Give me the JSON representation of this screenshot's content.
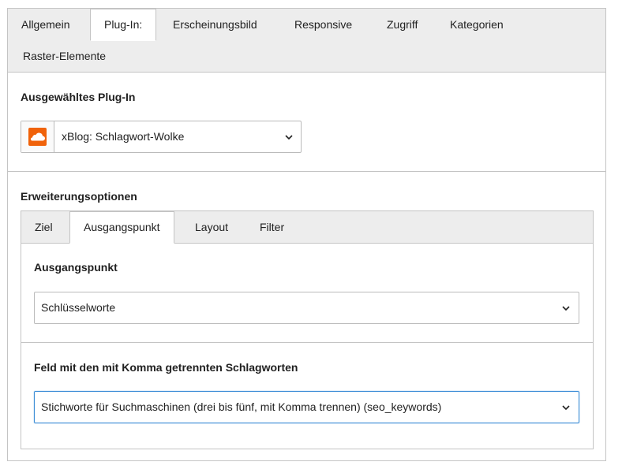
{
  "top_tabs": [
    {
      "label": "Allgemein",
      "active": false
    },
    {
      "label": "Plug-In:",
      "active": true
    },
    {
      "label": "Erscheinungsbild",
      "active": false
    },
    {
      "label": "Responsive",
      "active": false
    },
    {
      "label": "Zugriff",
      "active": false
    },
    {
      "label": "Kategorien",
      "active": false
    },
    {
      "label": "Raster-Elemente",
      "active": false
    }
  ],
  "plugin_section": {
    "title": "Ausgewähltes Plug-In",
    "selected": "xBlog: Schlagwort-Wolke",
    "icon": "cloud-icon",
    "icon_color": "#f0620a"
  },
  "extension_section": {
    "title": "Erweiterungsoptionen",
    "tabs": [
      {
        "label": "Ziel",
        "active": false
      },
      {
        "label": "Ausgangspunkt",
        "active": true
      },
      {
        "label": "Layout",
        "active": false
      },
      {
        "label": "Filter",
        "active": false
      }
    ],
    "origin": {
      "title": "Ausgangspunkt",
      "selected": "Schlüsselworte"
    },
    "keywords_field": {
      "title": "Feld mit den mit Komma getrennten Schlagworten",
      "selected": "Stichworte für Suchmaschinen (drei bis fünf, mit Komma trennen) (seo_keywords)"
    }
  },
  "colors": {
    "focus_border": "#3c8dd6",
    "tab_bar": "#ededed",
    "border": "#c4c4c4"
  }
}
